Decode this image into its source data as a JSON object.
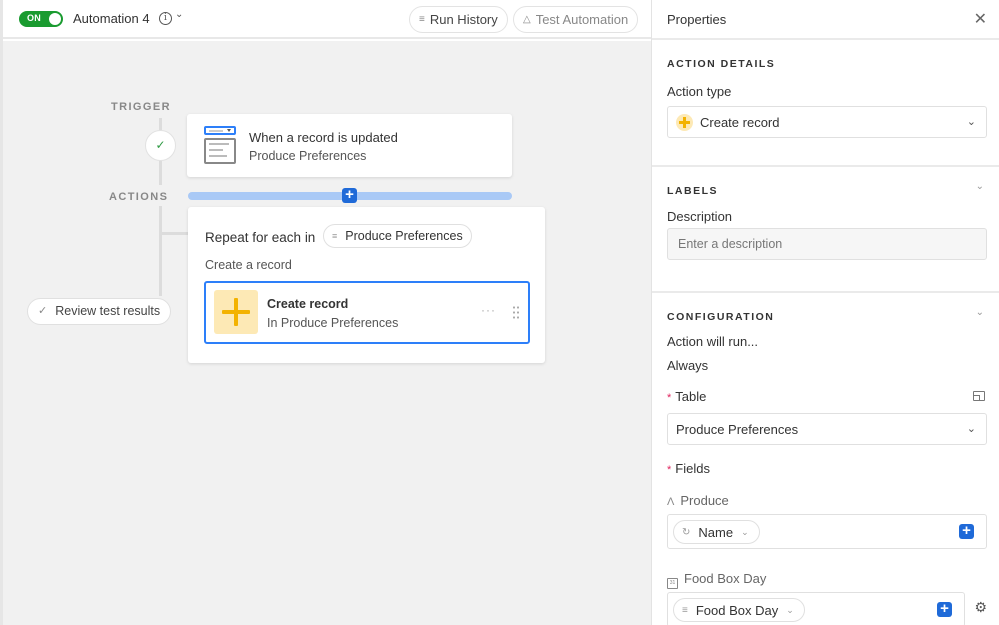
{
  "topbar": {
    "toggle_label": "ON",
    "automation_name": "Automation 4",
    "run_history_label": "Run History",
    "test_automation_label": "Test Automation"
  },
  "canvas": {
    "trigger_section_label": "TRIGGER",
    "actions_section_label": "ACTIONS",
    "trigger": {
      "title": "When a record is updated",
      "table": "Produce Preferences"
    },
    "repeat": {
      "label": "Repeat for each in",
      "source": "Produce Preferences",
      "inner_label": "Create a record",
      "action": {
        "title": "Create record",
        "subtitle": "In Produce Preferences"
      }
    },
    "review_button_label": "Review test results"
  },
  "panel": {
    "title": "Properties",
    "action_details": {
      "heading": "ACTION DETAILS",
      "action_type_label": "Action type",
      "action_type_value": "Create record"
    },
    "labels": {
      "heading": "LABELS",
      "description_label": "Description",
      "description_placeholder": "Enter a description",
      "description_value": ""
    },
    "configuration": {
      "heading": "CONFIGURATION",
      "run_label": "Action will run...",
      "run_value": "Always",
      "table_label": "Table",
      "table_required": "*",
      "table_value": "Produce Preferences",
      "fields_label": "Fields",
      "fields_required": "*",
      "fields": [
        {
          "name": "Produce",
          "type_icon": "A",
          "token": "Name"
        },
        {
          "name": "Food Box Day",
          "type_icon": "31",
          "token": "Food Box Day"
        }
      ]
    }
  },
  "colors": {
    "toggle_on": "#1a9b30",
    "accent_blue": "#1f6ad8",
    "selection_blue": "#2d7ff9",
    "create_yellow": "#f3b200",
    "required_red": "#e0245e"
  }
}
